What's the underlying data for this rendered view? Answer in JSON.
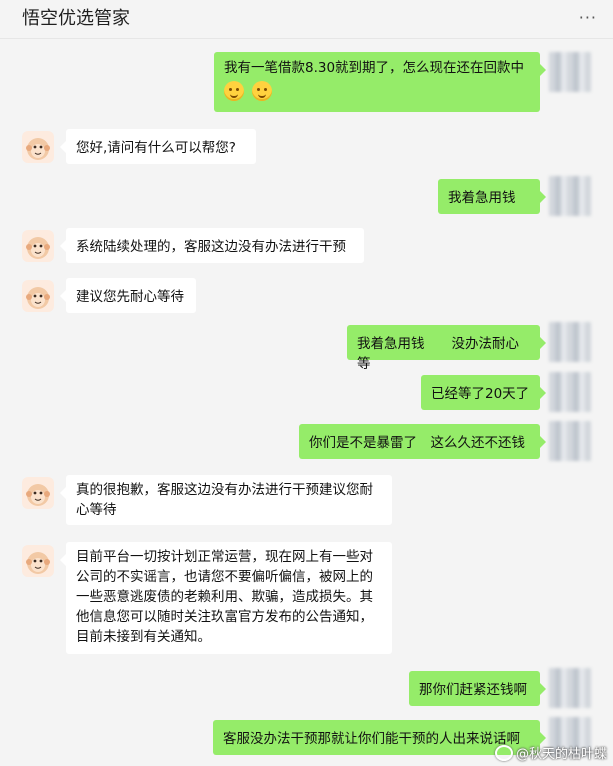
{
  "header": {
    "title": "悟空优选管家",
    "more_icon": "more-dots-icon",
    "more_glyph": "···"
  },
  "colors": {
    "outgoing_bubble": "#95ec69",
    "incoming_bubble": "#ffffff",
    "background": "#f4f4f4"
  },
  "messages": [
    {
      "side": "out",
      "text": "我有一笔借款8.30就到期了，怎么现在还在回款中",
      "emoji_count": 2,
      "emoji_icon": "smile-emoji-icon"
    },
    {
      "side": "in",
      "text": "您好,请问有什么可以帮您?"
    },
    {
      "side": "out",
      "text": "我着急用钱"
    },
    {
      "side": "in",
      "text": "系统陆续处理的，客服这边没有办法进行干预"
    },
    {
      "side": "in",
      "text": "建议您先耐心等待"
    },
    {
      "side": "out",
      "text": "我着急用钱　　没办法耐心等"
    },
    {
      "side": "out",
      "text": "已经等了20天了"
    },
    {
      "side": "out",
      "text": "你们是不是暴雷了　这么久还不还钱"
    },
    {
      "side": "in",
      "text": "真的很抱歉，客服这边没有办法进行干预建议您耐心等待"
    },
    {
      "side": "in",
      "text": "目前平台一切按计划正常运营，现在网上有一些对公司的不实谣言，也请您不要偏听偏信，被网上的一些恶意逃废债的老赖利用、欺骗，造成损失。其他信息您可以随时关注玖富官方发布的公告通知，目前未接到有关通知。"
    },
    {
      "side": "out",
      "text": "那你们赶紧还钱啊"
    },
    {
      "side": "out",
      "text": "客服没办法干预那就让你们能干预的人出来说话啊"
    }
  ],
  "watermark": {
    "text": "@秋天的枯叶蝶",
    "icon": "weibo-icon"
  }
}
